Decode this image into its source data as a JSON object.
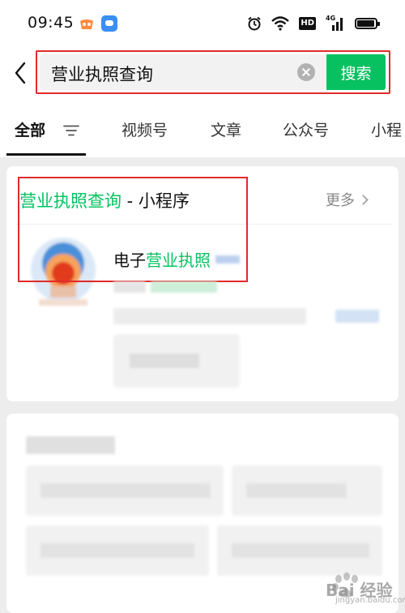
{
  "status_bar": {
    "time": "09:45",
    "icons": [
      "game-app-icon",
      "message-app-icon",
      "alarm-icon",
      "wifi-icon",
      "hd-icon",
      "signal-4g-icon",
      "battery-icon"
    ],
    "network_label": "HD",
    "signal_label": "4G"
  },
  "search": {
    "query": "营业执照查询",
    "button_label": "搜索",
    "accent_color": "#07c160"
  },
  "tabs": [
    {
      "label": "全部",
      "active": true
    },
    {
      "label": "视频号",
      "active": false
    },
    {
      "label": "文章",
      "active": false
    },
    {
      "label": "公众号",
      "active": false
    },
    {
      "label": "小程",
      "active": false
    }
  ],
  "result_section": {
    "title_highlight": "营业执照查询",
    "title_rest": " - 小程序",
    "more_label": "更多",
    "item": {
      "title_prefix": "电子",
      "title_highlight": "营业执照"
    }
  },
  "watermark": {
    "text": "Bai 经验",
    "sub": "jingyan.baidu.com"
  }
}
